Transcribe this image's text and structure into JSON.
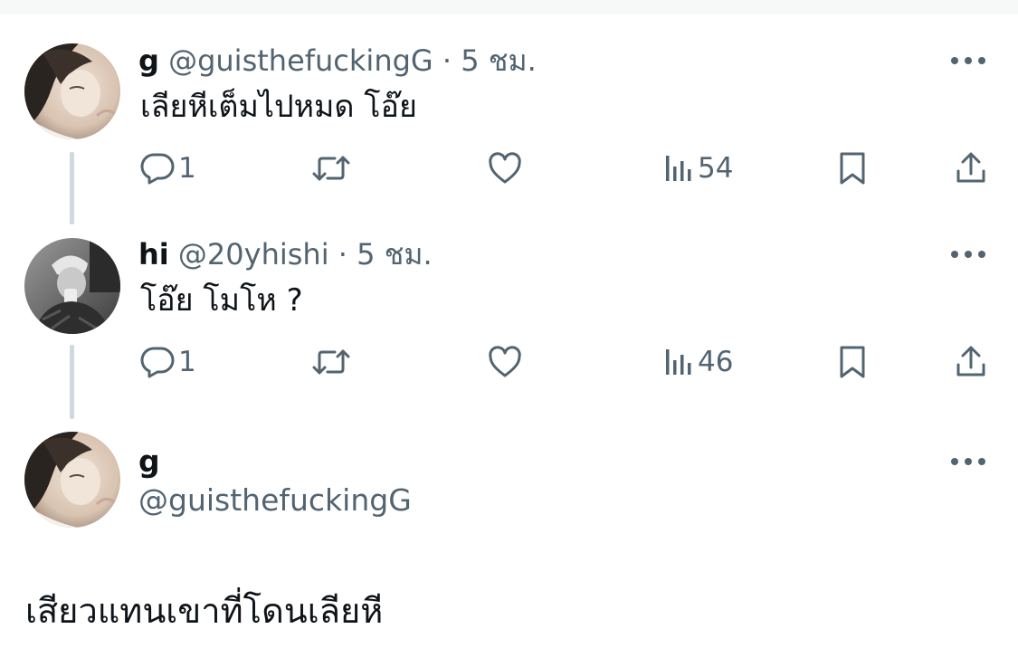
{
  "tweets": [
    {
      "name": "g",
      "handle": "@guisthefuckingG",
      "separator": "·",
      "time": "5 ชม.",
      "text": "เลียหีเต็มไปหมด โอ๊ย",
      "replies": "1",
      "views": "54"
    },
    {
      "name": "hi",
      "handle": "@20yhishi",
      "separator": "·",
      "time": "5 ชม.",
      "text": "โอ๊ย โมโห ?",
      "replies": "1",
      "views": "46"
    }
  ],
  "main_tweet": {
    "name": "g",
    "handle": "@guisthefuckingG",
    "text": "เสียวแทนเขาที่โดนเลียหี"
  },
  "icons": {
    "reply": "reply-icon",
    "retweet": "retweet-icon",
    "like": "like-icon",
    "views": "views-icon",
    "bookmark": "bookmark-icon",
    "share": "share-icon",
    "more": "more-icon"
  },
  "colors": {
    "text": "#0f1419",
    "secondary": "#536471",
    "thread_line": "#cfd9de"
  }
}
